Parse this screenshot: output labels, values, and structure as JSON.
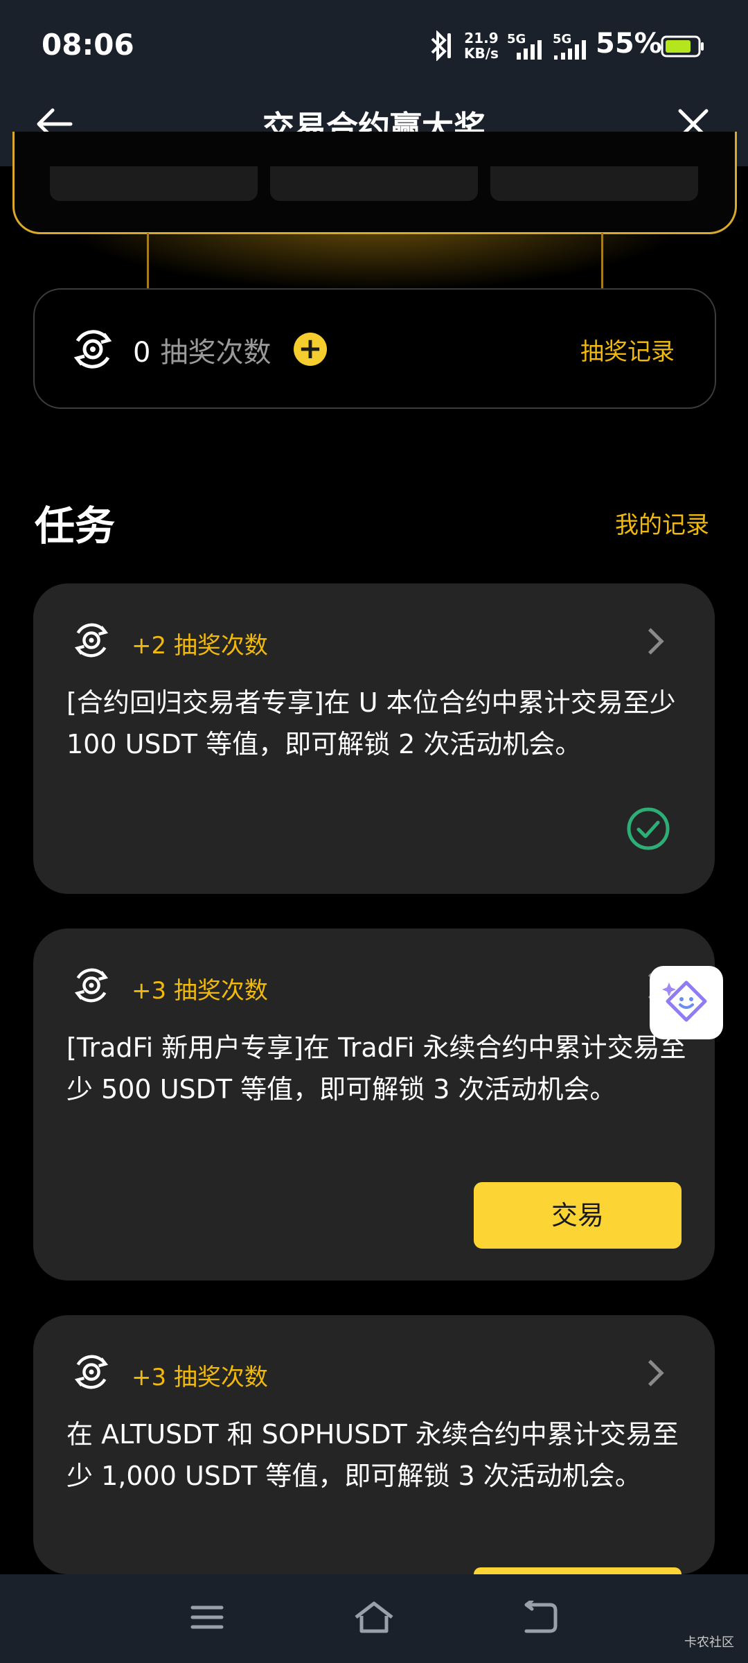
{
  "status_bar": {
    "time": "08:06",
    "net_speed_value": "21.9",
    "net_speed_unit": "KB/s",
    "signal1": "5G",
    "signal2": "5G",
    "battery_percent": "55%"
  },
  "header": {
    "title": "交易合约赢大奖",
    "back_icon": "arrow-left-icon",
    "close_icon": "close-icon"
  },
  "draws": {
    "count": "0",
    "label": "抽奖次数",
    "record_link": "抽奖记录"
  },
  "tasks_section": {
    "title": "任务",
    "my_record_link": "我的记录"
  },
  "tasks": [
    {
      "reward": "+2 抽奖次数",
      "description": "[合约回归交易者专享]在 U 本位合约中累计交易至少 100 USDT 等值，即可解锁 2 次活动机会。",
      "status": "completed"
    },
    {
      "reward": "+3 抽奖次数",
      "description": "[TradFi 新用户专享]在 TradFi 永续合约中累计交易至少 500 USDT 等值，即可解锁 3 次活动机会。",
      "button_label": "交易"
    },
    {
      "reward": "+3 抽奖次数",
      "description": "在 ALTUSDT 和 SOPHUSDT 永续合约中累计交易至少 1,000 USDT 等值，即可解锁 3 次活动机会。"
    }
  ],
  "watermark": "卡农社区",
  "colors": {
    "accent": "#f0b90b",
    "button": "#fcd535",
    "success": "#2eae77",
    "card_bg": "#252525",
    "bar_bg": "#1b212b"
  }
}
